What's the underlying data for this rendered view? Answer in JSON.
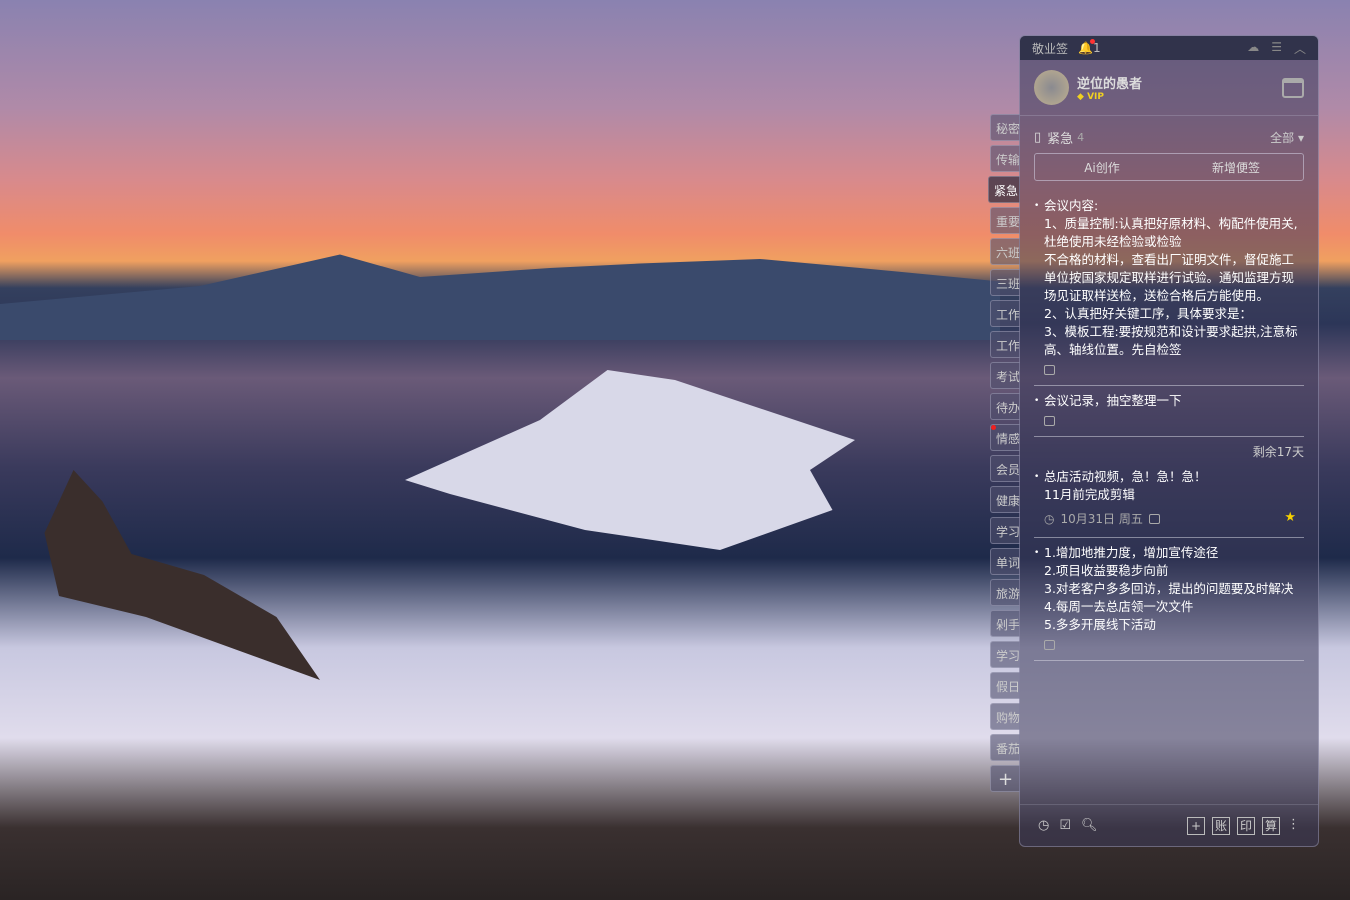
{
  "app": {
    "title": "敬业签",
    "notify_count": "1"
  },
  "user": {
    "name": "逆位的愚者",
    "badge": "VIP"
  },
  "category": {
    "name": "紧急",
    "count": "4",
    "filter": "全部"
  },
  "actions": {
    "ai": "Ai创作",
    "new": "新增便签"
  },
  "tabs": [
    "秘密",
    "传输",
    "紧急",
    "重要",
    "六班",
    "三班",
    "工作",
    "工作",
    "考试",
    "待办",
    "情感",
    "会员",
    "健康",
    "学习",
    "单词",
    "旅游",
    "剁手",
    "学习",
    "假日",
    "购物",
    "番茄"
  ],
  "notes": [
    {
      "text": "会议内容:\n1、质量控制:认真把好原材料、构配件使用关,杜绝使用未经检验或检验\n不合格的材料，查看出厂证明文件，督促施工单位按国家规定取样进行试验。通知监理方现场见证取样送检，送检合格后方能使用。\n2、认真把好关键工序，具体要求是：\n3、模板工程:要按规范和设计要求起拱,注意标高、轴线位置。先自检签"
    },
    {
      "text": "会议记录，抽空整理一下"
    },
    {
      "remaining": "剩余17天",
      "text": "总店活动视频，急！急！急！\n11月前完成剪辑",
      "date": "10月31日 周五"
    },
    {
      "text": "1.增加地推力度，增加宣传途径\n2.项目收益要稳步向前\n3.对老客户多多回访，提出的问题要及时解决\n4.每周一去总店领一次文件\n5.多多开展线下活动"
    }
  ],
  "footer": {
    "buttons": [
      "+",
      "账",
      "印",
      "算"
    ]
  }
}
